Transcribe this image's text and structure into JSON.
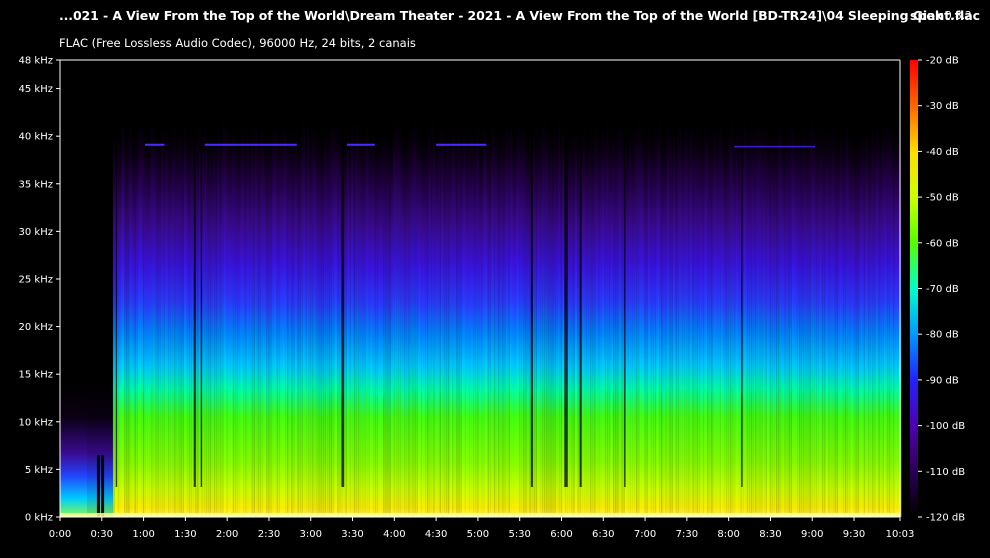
{
  "header": {
    "title": "...021 - A View From the Top of the World\\Dream Theater - 2021 - A View From the Top of the World [BD-TR24]\\04 Sleeping Giant.flac",
    "app_name": "spek",
    "app_version": "0.8.2",
    "subtitle": "FLAC (Free Lossless Audio Codec), 96000 Hz, 24 bits, 2 canais"
  },
  "chart_data": {
    "type": "heatmap",
    "x_ticks": [
      "0:00",
      "0:30",
      "1:00",
      "1:30",
      "2:00",
      "2:30",
      "3:00",
      "3:30",
      "4:00",
      "4:30",
      "5:00",
      "5:30",
      "6:00",
      "6:30",
      "7:00",
      "7:30",
      "8:00",
      "8:30",
      "9:00",
      "9:30",
      "10:03"
    ],
    "x_tick_seconds": [
      0,
      30,
      60,
      90,
      120,
      150,
      180,
      210,
      240,
      270,
      300,
      330,
      360,
      390,
      420,
      450,
      480,
      510,
      540,
      570,
      603
    ],
    "x_range_seconds": [
      0,
      603
    ],
    "y_ticks": [
      "0 kHz",
      "5 kHz",
      "10 kHz",
      "15 kHz",
      "20 kHz",
      "25 kHz",
      "30 kHz",
      "35 kHz",
      "40 kHz",
      "45 kHz",
      "48 kHz"
    ],
    "y_tick_khz": [
      0,
      5,
      10,
      15,
      20,
      25,
      30,
      35,
      40,
      45,
      48
    ],
    "y_range_khz": [
      0,
      48
    ],
    "colorbar_ticks": [
      "-20 dB",
      "-30 dB",
      "-40 dB",
      "-50 dB",
      "-60 dB",
      "-70 dB",
      "-80 dB",
      "-90 dB",
      "-100 dB",
      "-110 dB",
      "-120 dB"
    ],
    "colorbar_values_db": [
      -20,
      -30,
      -40,
      -50,
      -60,
      -70,
      -80,
      -90,
      -100,
      -110,
      -120
    ],
    "colorbar_range_db": [
      -120,
      -20
    ],
    "colormap": [
      "#000000",
      "#2a0055",
      "#5000b0",
      "#2222ff",
      "#0099ff",
      "#00ffcc",
      "#55ff00",
      "#ccff00",
      "#ffdd00",
      "#ff6600",
      "#ff0000"
    ]
  }
}
